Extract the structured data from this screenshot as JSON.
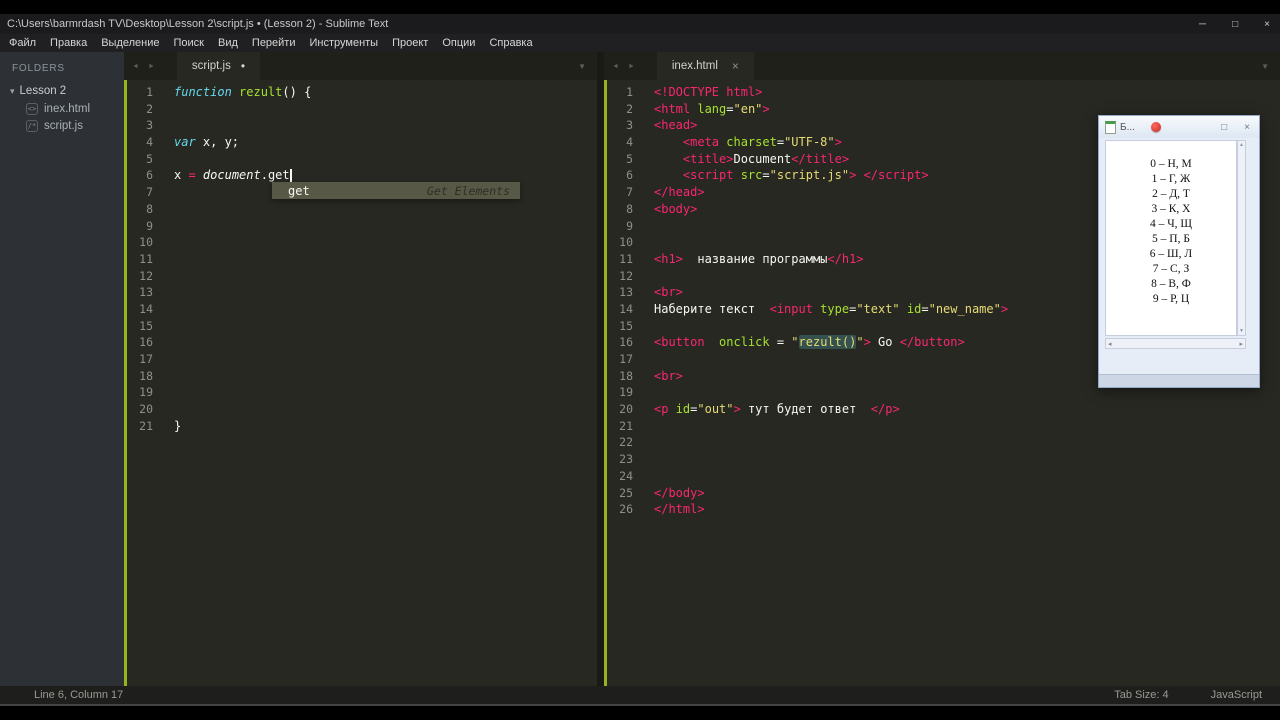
{
  "window": {
    "title": "C:\\Users\\barmrdash TV\\Desktop\\Lesson 2\\script.js • (Lesson 2) - Sublime Text",
    "controls": {
      "minimize": "─",
      "maximize": "□",
      "close": "×"
    }
  },
  "menu": {
    "items": [
      "Файл",
      "Правка",
      "Выделение",
      "Поиск",
      "Вид",
      "Перейти",
      "Инструменты",
      "Проект",
      "Опции",
      "Справка"
    ]
  },
  "sidebar": {
    "header": "FOLDERS",
    "folder": "Lesson 2",
    "files": [
      {
        "name": "inex.html",
        "icon": "<>"
      },
      {
        "name": "script.js",
        "icon": "/*"
      }
    ]
  },
  "icons": {
    "tab_prev": "◄",
    "tab_next": "►",
    "tab_overflow": "▼",
    "close": "×",
    "folder_arrow": "▾",
    "h_left": "◂",
    "h_right": "▸",
    "v_up": "▲",
    "v_down": "▼"
  },
  "panes": {
    "left": {
      "tab": "script.js",
      "dot": "•",
      "lines": [
        [
          [
            "function ",
            "k"
          ],
          [
            "rezult",
            "f"
          ],
          [
            "() {",
            "w"
          ]
        ],
        [],
        [],
        [
          [
            "var",
            "k"
          ],
          [
            " x, y;",
            "w"
          ]
        ],
        [],
        [
          [
            "x ",
            "w"
          ],
          [
            "=",
            "t"
          ],
          [
            " ",
            "w"
          ],
          [
            "document",
            "i"
          ],
          [
            ".get",
            "w"
          ],
          [
            "",
            "caret"
          ]
        ],
        [],
        [],
        [],
        [],
        [],
        [],
        [],
        [],
        [],
        [],
        [],
        [],
        [],
        [],
        [
          [
            "}",
            "w"
          ]
        ]
      ]
    },
    "right": {
      "tab": "inex.html",
      "lines": [
        [
          [
            "<!DOCTYPE html>",
            "t"
          ]
        ],
        [
          [
            "<html ",
            "t"
          ],
          [
            "lang",
            "a"
          ],
          [
            "=",
            "w"
          ],
          [
            "\"en\"",
            "s"
          ],
          [
            ">",
            "t"
          ]
        ],
        [
          [
            "<head>",
            "t"
          ]
        ],
        [
          [
            "    <meta ",
            "t"
          ],
          [
            "charset",
            "a"
          ],
          [
            "=",
            "w"
          ],
          [
            "\"UTF-8\"",
            "s"
          ],
          [
            ">",
            "t"
          ]
        ],
        [
          [
            "    <title>",
            "t"
          ],
          [
            "Document",
            "w"
          ],
          [
            "</title>",
            "t"
          ]
        ],
        [
          [
            "    <script ",
            "t"
          ],
          [
            "src",
            "a"
          ],
          [
            "=",
            "w"
          ],
          [
            "\"script.js\"",
            "s"
          ],
          [
            "> ",
            "t"
          ],
          [
            "</script>",
            "t"
          ]
        ],
        [
          [
            "</head>",
            "t"
          ]
        ],
        [
          [
            "<body>",
            "t"
          ]
        ],
        [],
        [],
        [
          [
            "<h1>",
            "t"
          ],
          [
            "  название программы",
            "w"
          ],
          [
            "</h1>",
            "t"
          ]
        ],
        [],
        [
          [
            "<br>",
            "t"
          ]
        ],
        [
          [
            "Наберите текст  ",
            "w"
          ],
          [
            "<input ",
            "t"
          ],
          [
            "type",
            "a"
          ],
          [
            "=",
            "w"
          ],
          [
            "\"text\"",
            "s"
          ],
          [
            " ",
            "w"
          ],
          [
            "id",
            "a"
          ],
          [
            "=",
            "w"
          ],
          [
            "\"new_name\"",
            "s"
          ],
          [
            ">",
            "t"
          ]
        ],
        [],
        [
          [
            "<button  ",
            "t"
          ],
          [
            "onclick",
            "a"
          ],
          [
            " = ",
            "w"
          ],
          [
            "\"",
            "s"
          ],
          [
            "rezult()",
            "hl"
          ],
          [
            "\"",
            "s"
          ],
          [
            "> ",
            "t"
          ],
          [
            "Go ",
            "w"
          ],
          [
            "</button>",
            "t"
          ]
        ],
        [],
        [
          [
            "<br>",
            "t"
          ]
        ],
        [],
        [
          [
            "<p ",
            "t"
          ],
          [
            "id",
            "a"
          ],
          [
            "=",
            "w"
          ],
          [
            "\"out\"",
            "s"
          ],
          [
            ">",
            "t"
          ],
          [
            " тут будет ответ  ",
            "w"
          ],
          [
            "</p>",
            "t"
          ]
        ],
        [],
        [],
        [],
        [],
        [
          [
            "</body>",
            "t"
          ]
        ],
        [
          [
            "</html>",
            "t"
          ]
        ]
      ]
    }
  },
  "completion": {
    "label": "get",
    "hint": "Get Elements"
  },
  "status": {
    "position": "Line 6, Column 17",
    "tab_size": "Tab Size: 4",
    "syntax": "JavaScript"
  },
  "float_window": {
    "title": "Б...",
    "controls": {
      "maximize": "□",
      "close": "×"
    },
    "rows": [
      "0 – Н, М",
      "1 – Г, Ж",
      "2 – Д, Т",
      "3 – К, Х",
      "4 – Ч, Щ",
      "5 – П, Б",
      "6 – Ш, Л",
      "7 – С, З",
      "8 – В, Ф",
      "9 – Р, Ц"
    ]
  }
}
